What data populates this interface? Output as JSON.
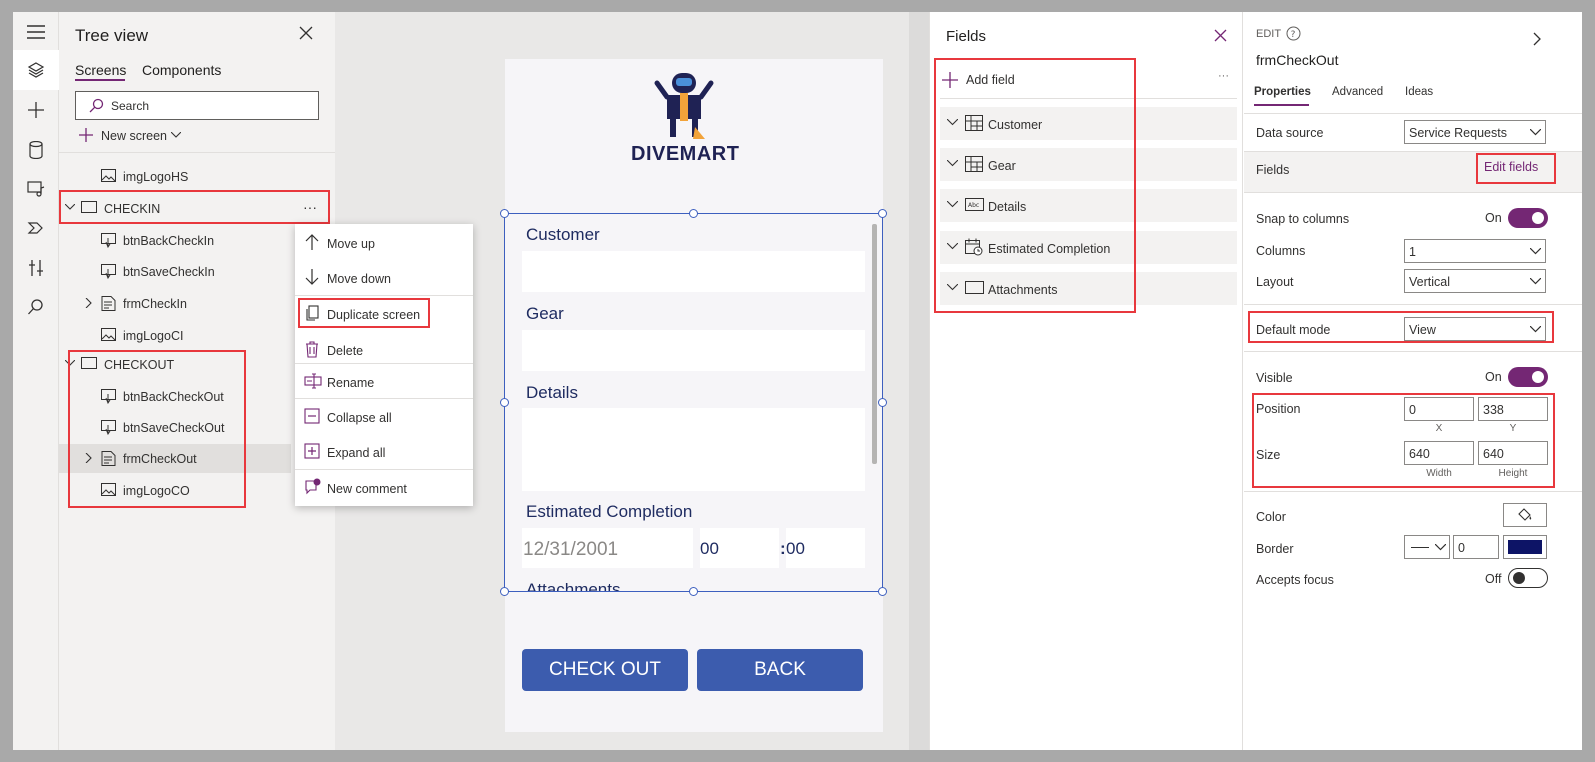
{
  "tree": {
    "title": "Tree view",
    "tabs": [
      "Screens",
      "Components"
    ],
    "search_placeholder": "Search",
    "new_screen": "New screen",
    "items": [
      {
        "label": "imgLogoHS",
        "icon": "image-icon"
      },
      {
        "label": "CHECKIN",
        "icon": "screen-icon",
        "more": "···"
      },
      {
        "label": "btnBackCheckIn",
        "icon": "button-icon"
      },
      {
        "label": "btnSaveCheckIn",
        "icon": "button-icon"
      },
      {
        "label": "frmCheckIn",
        "icon": "form-icon"
      },
      {
        "label": "imgLogoCI",
        "icon": "image-icon"
      },
      {
        "label": "CHECKOUT",
        "icon": "screen-icon"
      },
      {
        "label": "btnBackCheckOut",
        "icon": "button-icon"
      },
      {
        "label": "btnSaveCheckOut",
        "icon": "button-icon"
      },
      {
        "label": "frmCheckOut",
        "icon": "form-icon"
      },
      {
        "label": "imgLogoCO",
        "icon": "image-icon"
      }
    ]
  },
  "context_menu": {
    "items": [
      "Move up",
      "Move down",
      "Duplicate screen",
      "Delete",
      "Rename",
      "Collapse all",
      "Expand all",
      "New comment"
    ]
  },
  "canvas": {
    "brand": "DIVEMART",
    "form_labels": [
      "Customer",
      "Gear",
      "Details",
      "Estimated Completion",
      "Attachments"
    ],
    "date_value": "12/31/2001",
    "hour_value": "00",
    "minute_value": "00",
    "colon": ":",
    "buttons": {
      "checkout": "CHECK OUT",
      "back": "BACK"
    }
  },
  "fields_panel": {
    "title": "Fields",
    "add_field": "Add field",
    "more": "···",
    "fields": [
      {
        "label": "Customer",
        "icon": "grid-card-icon"
      },
      {
        "label": "Gear",
        "icon": "grid-card-icon"
      },
      {
        "label": "Details",
        "icon": "text-abc-icon"
      },
      {
        "label": "Estimated Completion",
        "icon": "calendar-clock-icon"
      },
      {
        "label": "Attachments",
        "icon": "box-icon"
      }
    ]
  },
  "properties": {
    "edit_label": "EDIT",
    "control_name": "frmCheckOut",
    "tabs": [
      "Properties",
      "Advanced",
      "Ideas"
    ],
    "data_source_label": "Data source",
    "data_source_value": "Service Requests",
    "fields_label": "Fields",
    "edit_fields": "Edit fields",
    "snap_label": "Snap to columns",
    "snap_state": "On",
    "columns_label": "Columns",
    "columns_value": "1",
    "layout_label": "Layout",
    "layout_value": "Vertical",
    "default_mode_label": "Default mode",
    "default_mode_value": "View",
    "visible_label": "Visible",
    "visible_state": "On",
    "position_label": "Position",
    "position_x": "0",
    "position_y": "338",
    "x_label": "X",
    "y_label": "Y",
    "size_label": "Size",
    "width_value": "640",
    "height_value": "640",
    "width_label": "Width",
    "height_label": "Height",
    "color_label": "Color",
    "border_label": "Border",
    "border_value": "0",
    "border_color": "#0d1466",
    "accepts_focus_label": "Accepts focus",
    "accepts_focus_state": "Off"
  },
  "colors": {
    "accent": "#742774",
    "highlight": "#e8383d",
    "button": "#3c5cae",
    "brand_text": "#1f2254"
  }
}
